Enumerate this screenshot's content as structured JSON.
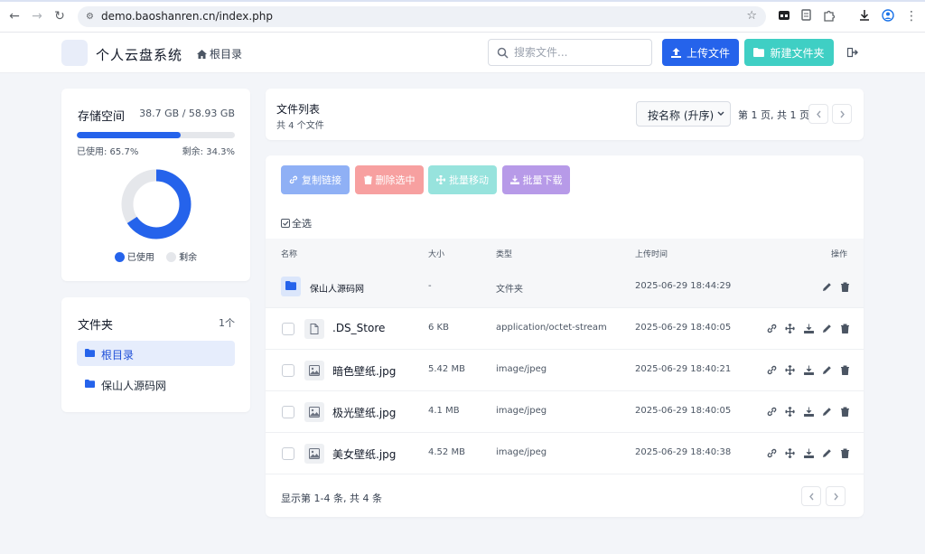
{
  "browser": {
    "url": "demo.baoshanren.cn/index.php"
  },
  "header": {
    "title": "个人云盘系统",
    "home_label": "根目录",
    "search_placeholder": "搜索文件...",
    "upload_label": "上传文件",
    "new_folder_label": "新建文件夹"
  },
  "storage": {
    "title": "存储空间",
    "used_total": "38.7 GB / 58.93 GB",
    "used_label": "已使用: 65.7%",
    "free_label": "剩余: 34.3%",
    "used_fraction": 0.657,
    "legend_used": "已使用",
    "legend_free": "剩余",
    "color_used": "#2563eb",
    "color_free": "#e5e7eb"
  },
  "folders": {
    "title": "文件夹",
    "count": "1个",
    "items": [
      {
        "label": "根目录",
        "active": true
      },
      {
        "label": "保山人源码网",
        "active": false
      }
    ]
  },
  "list": {
    "title": "文件列表",
    "subtitle": "共 4 个文件",
    "sort_value": "按名称 (升序)",
    "page_info": "第 1 页, 共 1 页"
  },
  "bulk_actions": [
    {
      "label": "复制链接",
      "color": "#8fb0f5",
      "icon": "link-icon"
    },
    {
      "label": "删除选中",
      "color": "#f7a0a0",
      "icon": "trash-icon"
    },
    {
      "label": "批量移动",
      "color": "#97e3dd",
      "icon": "move-icon"
    },
    {
      "label": "批量下载",
      "color": "#b79ae8",
      "icon": "download-icon"
    }
  ],
  "select_all_label": "全选",
  "table": {
    "columns": {
      "name": "名称",
      "size": "大小",
      "type": "类型",
      "time": "上传时间",
      "actions": "操作"
    },
    "rows": [
      {
        "kind": "folder",
        "name": "保山人源码网",
        "size": "-",
        "type": "文件夹",
        "time": "2025-06-29 18:44:29"
      },
      {
        "kind": "file",
        "name": ".DS_Store",
        "size": "6 KB",
        "type": "application/octet-stream",
        "time": "2025-06-29 18:40:05"
      },
      {
        "kind": "image",
        "name": "暗色壁纸.jpg",
        "size": "5.42 MB",
        "type": "image/jpeg",
        "time": "2025-06-29 18:40:21"
      },
      {
        "kind": "image",
        "name": "极光壁纸.jpg",
        "size": "4.1 MB",
        "type": "image/jpeg",
        "time": "2025-06-29 18:40:05"
      },
      {
        "kind": "image",
        "name": "美女壁纸.jpg",
        "size": "4.52 MB",
        "type": "image/jpeg",
        "time": "2025-06-29 18:40:38"
      }
    ]
  },
  "footer_info": "显示第 1-4 条, 共 4 条"
}
